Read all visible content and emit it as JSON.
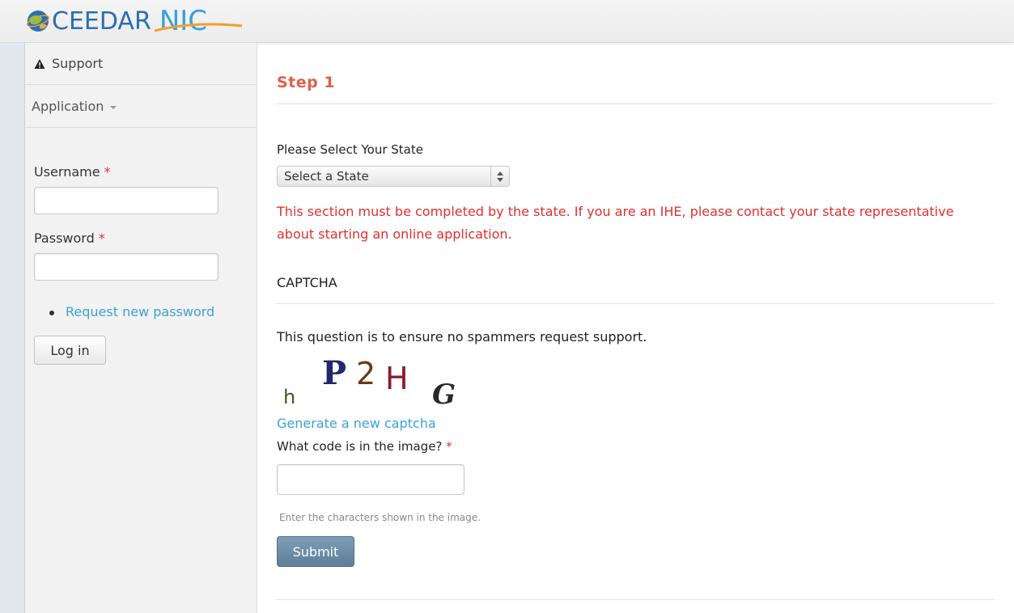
{
  "header": {
    "logo_part1": "CEEDAR",
    "logo_part2": "NIC"
  },
  "sidebar": {
    "items": [
      {
        "label": "Support",
        "icon": "warning-icon"
      },
      {
        "label": "Application",
        "icon": "caret-down-icon"
      }
    ],
    "login": {
      "username_label": "Username",
      "password_label": "Password",
      "required_mark": "*",
      "username_value": "",
      "password_value": "",
      "request_password_link": "Request new password",
      "login_button": "Log in"
    }
  },
  "main": {
    "step_title": "Step 1",
    "state_label": "Please Select Your State",
    "state_select_value": "Select a State",
    "warning_text": "This section must be completed by the state. If you are an IHE, please contact your state representative about starting an online application.",
    "captcha_heading": "CAPTCHA",
    "captcha_description": "This question is to ensure no spammers request support.",
    "captcha_chars": [
      "h",
      "P",
      "2",
      "H",
      "G"
    ],
    "generate_link": "Generate a new captcha",
    "code_label": "What code is in the image?",
    "required_mark": "*",
    "code_value": "",
    "help_text": "Enter the characters shown in the image.",
    "submit_button": "Submit"
  },
  "colors": {
    "step_title": "#e0604a",
    "warning": "#e0302f",
    "link": "#3aa3d6",
    "submit_bg": "#6b8ba5"
  }
}
